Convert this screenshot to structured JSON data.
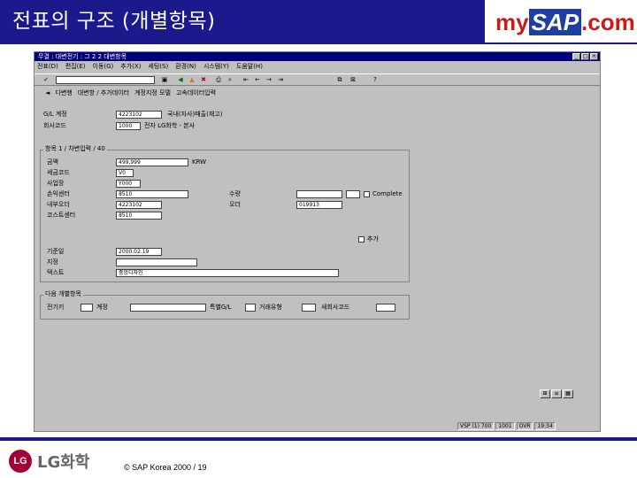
{
  "slide": {
    "title": "전표의 구조 (개별항목)",
    "logo": {
      "my": "my",
      "sap": "SAP",
      "com": ".com"
    }
  },
  "window": {
    "title": "무결 : 대변전기 : 그 2 2 대변항목",
    "menu": [
      "전표(D)",
      "편집(E)",
      "이동(G)",
      "추가(X)",
      "세팅(S)",
      "환경(N)",
      "시스템(Y)",
      "도움말(H)"
    ],
    "app_toolbar": [
      "다변행",
      "대변항 / 추가데이터",
      "계정지정 모델",
      "고속데이터입력"
    ],
    "header": {
      "gl_account_label": "G/L 계정",
      "gl_account_value": "4223102",
      "gl_account_desc": "국내(자사)매출(재고)",
      "company_code_label": "회사코드",
      "company_code_value": "1000",
      "company_code_desc": "전자 LG화학 - 본사"
    },
    "item": {
      "section_label": "항목 1 / 차변입력 / 40",
      "amount_label": "금액",
      "amount_value": "499,999",
      "currency": "KRW",
      "tax_code_label": "세금코드",
      "tax_code_value": "V0",
      "business_area_label": "사업장",
      "business_area_value": "Y000",
      "profit_center_label": "손익센터",
      "profit_center_value": "8510",
      "internal_order_label": "내부오더",
      "internal_order_value": "4223102",
      "cost_center_label": "코스트센터",
      "cost_center_value": "8510",
      "quantity_label": "수량",
      "quantity_value": "",
      "order_label": "오더",
      "order_value": "019913",
      "complete_label": "Complete",
      "more_label": "추가",
      "value_date_label": "기준일",
      "value_date_value": "2000.02.19",
      "assignment_label": "지정",
      "assignment_value": "",
      "text_label": "텍스트",
      "text_value": "중앙디자인"
    },
    "next_item": {
      "section_label": "다음 개별항목",
      "posting_key_label": "전기키",
      "posting_key_value": "",
      "account_label": "계정",
      "account_value": "",
      "special_gl_label": "특별G/L",
      "special_gl_value": "",
      "trans_type_label": "거래유형",
      "trans_type_value": "",
      "new_code_label": "새회사코드",
      "new_code_value": ""
    },
    "status": [
      "VSP (1) 700",
      "1001",
      "OVR",
      "19:34"
    ]
  },
  "footer": {
    "company": "LG화학",
    "lg_mark": "LG",
    "copyright": "© SAP Korea 2000 / 19"
  },
  "colors": {
    "title_band": "#1a1a8c",
    "sap_bg": "#c0c0c0",
    "titlebar": "#00007c",
    "lg_red": "#a50034"
  }
}
